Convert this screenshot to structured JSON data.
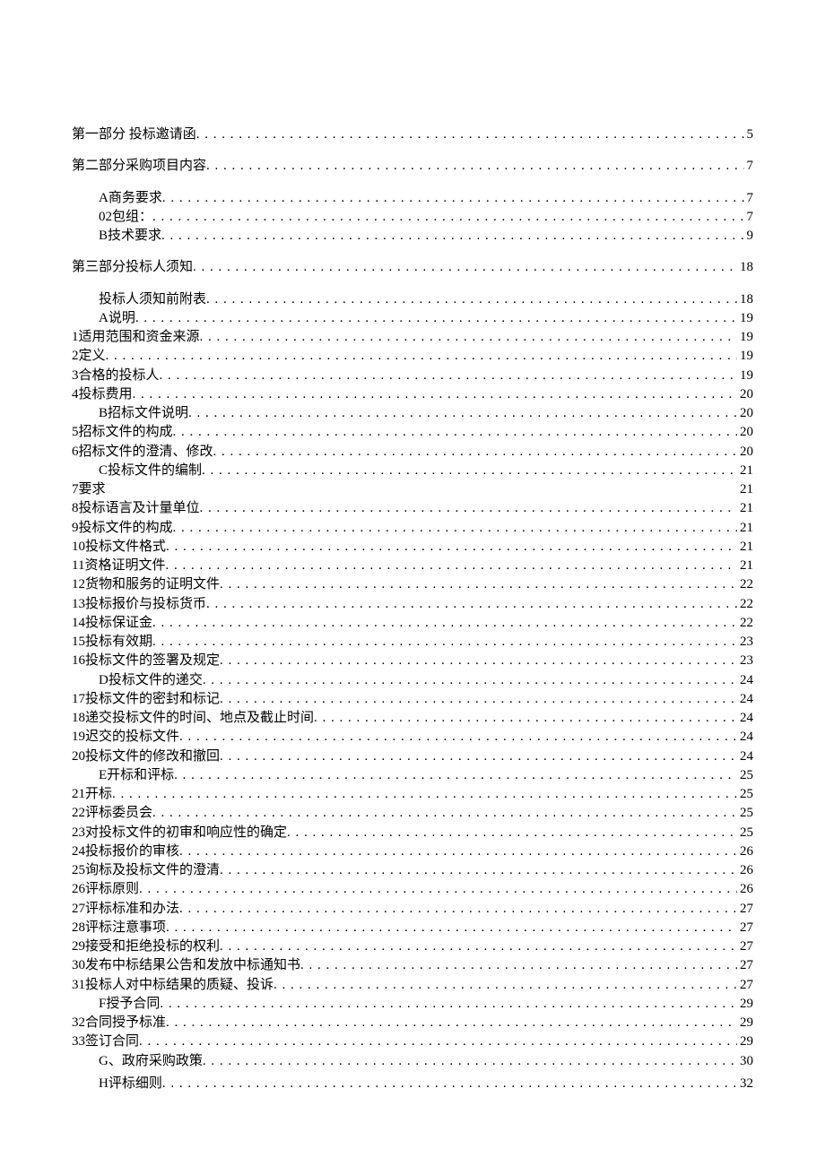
{
  "entries": [
    {
      "label": "第一部分  投标邀请函",
      "page": "5",
      "level": 0,
      "leader": true,
      "gapAfter": "lg"
    },
    {
      "label": "第二部分采购项目内容",
      "page": "7",
      "level": 0,
      "leader": true,
      "gapAfter": "lg"
    },
    {
      "label": "A商务要求",
      "page": "7",
      "level": 1,
      "leader": true
    },
    {
      "label": "02包组：",
      "page": "7",
      "level": 1,
      "leader": true
    },
    {
      "label": "B技术要求",
      "page": "9",
      "level": 1,
      "leader": true,
      "gapAfter": "lg"
    },
    {
      "label": "第三部分投标人须知",
      "page": "18",
      "level": 0,
      "leader": true,
      "gapAfter": "lg"
    },
    {
      "label": "投标人须知前附表",
      "page": "18",
      "level": 1,
      "leader": true
    },
    {
      "label": "A说明",
      "page": "19",
      "level": 1,
      "leader": true
    },
    {
      "label": "1适用范围和资金来源",
      "page": "19",
      "level": 0,
      "leader": true
    },
    {
      "label": "2定义",
      "page": "19",
      "level": 0,
      "leader": true
    },
    {
      "label": "3合格的投标人",
      "page": "19",
      "level": 0,
      "leader": true
    },
    {
      "label": "4投标费用",
      "page": "20",
      "level": 0,
      "leader": true
    },
    {
      "label": "B招标文件说明",
      "page": "20",
      "level": 1,
      "leader": true
    },
    {
      "label": "5招标文件的构成",
      "page": "20",
      "level": 0,
      "leader": true
    },
    {
      "label": "6招标文件的澄清、修改",
      "page": "20",
      "level": 0,
      "leader": true
    },
    {
      "label": "C投标文件的编制",
      "page": "21",
      "level": 1,
      "leader": true
    },
    {
      "label": "7要求",
      "page": "21",
      "level": 0,
      "leader": false
    },
    {
      "label": "8投标语言及计量单位",
      "page": "21",
      "level": 0,
      "leader": true
    },
    {
      "label": "9投标文件的构成",
      "page": "21",
      "level": 0,
      "leader": true
    },
    {
      "label": "10投标文件格式",
      "page": "21",
      "level": 0,
      "leader": true
    },
    {
      "label": "11资格证明文件",
      "page": "21",
      "level": 0,
      "leader": true
    },
    {
      "label": "12货物和服务的证明文件",
      "page": "22",
      "level": 0,
      "leader": true
    },
    {
      "label": "13投标报价与投标货币",
      "page": "22",
      "level": 0,
      "leader": true
    },
    {
      "label": "14投标保证金",
      "page": "22",
      "level": 0,
      "leader": true
    },
    {
      "label": "15投标有效期",
      "page": "23",
      "level": 0,
      "leader": true
    },
    {
      "label": "16投标文件的签署及规定",
      "page": "23",
      "level": 0,
      "leader": true
    },
    {
      "label": "D投标文件的递交",
      "page": "24",
      "level": 1,
      "leader": true
    },
    {
      "label": "17投标文件的密封和标记",
      "page": "24",
      "level": 0,
      "leader": true
    },
    {
      "label": "18递交投标文件的时间、地点及截止时间",
      "page": "24",
      "level": 0,
      "leader": true
    },
    {
      "label": "19迟交的投标文件",
      "page": "24",
      "level": 0,
      "leader": true
    },
    {
      "label": "20投标文件的修改和撤回",
      "page": "24",
      "level": 0,
      "leader": true
    },
    {
      "label": "E开标和评标",
      "page": "25",
      "level": 1,
      "leader": true
    },
    {
      "label": "21开标",
      "page": "25",
      "level": 0,
      "leader": true
    },
    {
      "label": "22评标委员会",
      "page": "25",
      "level": 0,
      "leader": true
    },
    {
      "label": "23对投标文件的初审和响应性的确定",
      "page": "25",
      "level": 0,
      "leader": true
    },
    {
      "label": "24投标报价的审核",
      "page": "26",
      "level": 0,
      "leader": true
    },
    {
      "label": "25询标及投标文件的澄清",
      "page": "26",
      "level": 0,
      "leader": true
    },
    {
      "label": "26评标原则",
      "page": "26",
      "level": 0,
      "leader": true
    },
    {
      "label": "27评标标准和办法",
      "page": "27",
      "level": 0,
      "leader": true
    },
    {
      "label": "28评标注意事项",
      "page": "27",
      "level": 0,
      "leader": true
    },
    {
      "label": "29接受和拒绝投标的权利",
      "page": "27",
      "level": 0,
      "leader": true
    },
    {
      "label": "30发布中标结果公告和发放中标通知书",
      "page": "27",
      "level": 0,
      "leader": true
    },
    {
      "label": "31投标人对中标结果的质疑、投诉",
      "page": "27",
      "level": 0,
      "leader": true
    },
    {
      "label": "F授予合同",
      "page": "29",
      "level": 1,
      "leader": true
    },
    {
      "label": "32合同授予标准",
      "page": "29",
      "level": 0,
      "leader": true
    },
    {
      "label": "33签订合同",
      "page": "29",
      "level": 0,
      "leader": true
    },
    {
      "label": "G、政府采购政策",
      "page": "30",
      "level": 1,
      "leader": true,
      "gapAfter": "sm"
    },
    {
      "label": "H评标细则",
      "page": "32",
      "level": 1,
      "leader": true
    }
  ]
}
